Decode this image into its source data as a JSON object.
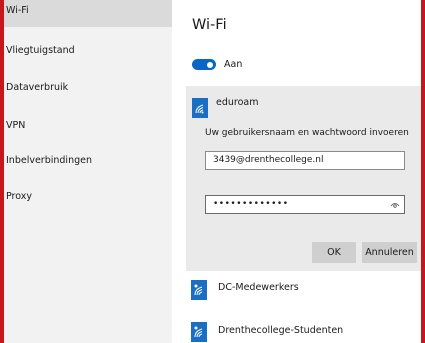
{
  "sidebar": {
    "items": [
      {
        "label": "Wi-Fi",
        "active": true
      },
      {
        "label": "Vliegtuigstand"
      },
      {
        "label": "Dataverbruik"
      },
      {
        "label": "VPN"
      },
      {
        "label": "Inbelverbindingen"
      },
      {
        "label": "Proxy"
      }
    ]
  },
  "main": {
    "title": "Wi-Fi",
    "toggle": {
      "label": "Aan",
      "state": "on"
    }
  },
  "network": {
    "name": "eduroam",
    "prompt": "Uw gebruikersnaam en wachtwoord invoeren",
    "username_value": "3439@drenthecollege.nl",
    "password_mask": "•••••••••••••",
    "ok_label": "OK",
    "cancel_label": "Annuleren"
  },
  "other_networks": [
    {
      "name": "DC-Medewerkers"
    },
    {
      "name": "Drenthecollege-Studenten"
    }
  ],
  "colors": {
    "accent": "#0a66c6",
    "wifi_badge": "#1a6fc4",
    "background_frame": "#e6262b"
  }
}
